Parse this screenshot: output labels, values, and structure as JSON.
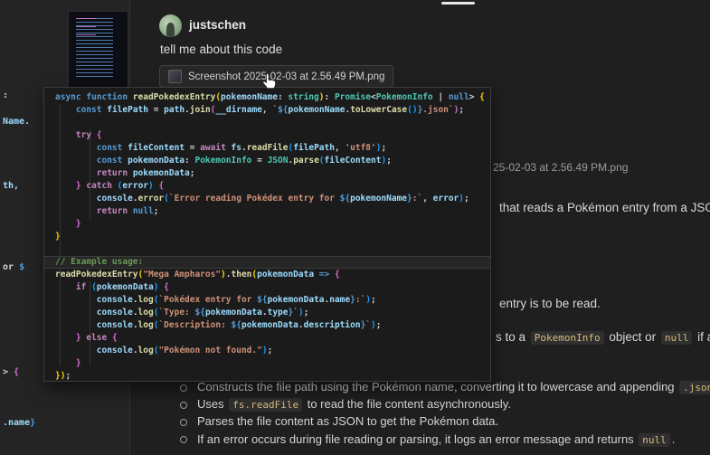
{
  "colors": {
    "editor_bg": "#242424",
    "chat_bg": "#1f1f1f",
    "popup_bg": "#1b1b1b",
    "popup_border": "#3c3c3c",
    "syntax": {
      "keyword": "#569CD6",
      "control": "#C586C0",
      "function": "#DCDCAA",
      "variable": "#9CDCFE",
      "type": "#4EC9B0",
      "string": "#CE9178",
      "comment": "#6A9955",
      "text": "#D4D4D4",
      "bracket1": "#FFD602",
      "bracket2": "#DA70D6",
      "bracket3": "#179FFF"
    },
    "inline_code_fg": "#d7ba7d"
  },
  "chat": {
    "username": "justschen",
    "message": "tell me about this code",
    "attachment": {
      "filename": "Screenshot 2025-02-03 at 2.56.49 PM.png"
    }
  },
  "editor_fragments": [
    [
      [
        "p",
        ":"
      ]
    ],
    [
      [
        "v",
        "Name."
      ]
    ],
    [
      [
        "v",
        "th,"
      ]
    ],
    [
      [
        "p",
        "or "
      ],
      [
        "kw",
        "$"
      ]
    ],
    [
      [
        "p",
        "> "
      ],
      [
        "b2",
        "{"
      ]
    ],
    [
      [
        "v",
        ".name"
      ],
      [
        "kw",
        "}"
      ]
    ]
  ],
  "hover_popup": {
    "highlight_line": 13,
    "code_lines": [
      [
        [
          "kw",
          "async function "
        ],
        [
          "fn",
          "readPokedexEntry"
        ],
        [
          "b1",
          "("
        ],
        [
          "v",
          "pokemonName"
        ],
        [
          "p",
          ": "
        ],
        [
          "ty",
          "string"
        ],
        [
          "b1",
          ")"
        ],
        [
          "p",
          ": "
        ],
        [
          "ty",
          "Promise"
        ],
        [
          "p",
          "<"
        ],
        [
          "ty",
          "PokemonInfo"
        ],
        [
          "p",
          " | "
        ],
        [
          "kw",
          "null"
        ],
        [
          "p",
          "> "
        ],
        [
          "b1",
          "{"
        ]
      ],
      [
        [
          "p",
          "    "
        ],
        [
          "kw",
          "const "
        ],
        [
          "v",
          "filePath"
        ],
        [
          "p",
          " = "
        ],
        [
          "v",
          "path"
        ],
        [
          "p",
          "."
        ],
        [
          "fn",
          "join"
        ],
        [
          "b2",
          "("
        ],
        [
          "v",
          "__dirname"
        ],
        [
          "p",
          ", "
        ],
        [
          "s",
          "`"
        ],
        [
          "kw",
          "${"
        ],
        [
          "v",
          "pokemonName"
        ],
        [
          "p",
          "."
        ],
        [
          "fn",
          "toLowerCase"
        ],
        [
          "b3",
          "()"
        ],
        [
          "kw",
          "}"
        ],
        [
          "s",
          ".json`"
        ],
        [
          "b2",
          ")"
        ],
        [
          "p",
          ";"
        ]
      ],
      [],
      [
        [
          "p",
          "    "
        ],
        [
          "ctl",
          "try "
        ],
        [
          "b2",
          "{"
        ]
      ],
      [
        [
          "p",
          "        "
        ],
        [
          "kw",
          "const "
        ],
        [
          "v",
          "fileContent"
        ],
        [
          "p",
          " = "
        ],
        [
          "ctl",
          "await "
        ],
        [
          "v",
          "fs"
        ],
        [
          "p",
          "."
        ],
        [
          "fn",
          "readFile"
        ],
        [
          "b3",
          "("
        ],
        [
          "v",
          "filePath"
        ],
        [
          "p",
          ", "
        ],
        [
          "s",
          "'utf8'"
        ],
        [
          "b3",
          ")"
        ],
        [
          "p",
          ";"
        ]
      ],
      [
        [
          "p",
          "        "
        ],
        [
          "kw",
          "const "
        ],
        [
          "v",
          "pokemonData"
        ],
        [
          "p",
          ": "
        ],
        [
          "ty",
          "PokemonInfo"
        ],
        [
          "p",
          " = "
        ],
        [
          "ty",
          "JSON"
        ],
        [
          "p",
          "."
        ],
        [
          "fn",
          "parse"
        ],
        [
          "b3",
          "("
        ],
        [
          "v",
          "fileContent"
        ],
        [
          "b3",
          ")"
        ],
        [
          "p",
          ";"
        ]
      ],
      [
        [
          "p",
          "        "
        ],
        [
          "ctl",
          "return "
        ],
        [
          "v",
          "pokemonData"
        ],
        [
          "p",
          ";"
        ]
      ],
      [
        [
          "p",
          "    "
        ],
        [
          "b2",
          "}"
        ],
        [
          "ctl",
          " catch "
        ],
        [
          "b3",
          "("
        ],
        [
          "v",
          "error"
        ],
        [
          "b3",
          ")"
        ],
        [
          "b2",
          " {"
        ]
      ],
      [
        [
          "p",
          "        "
        ],
        [
          "v",
          "console"
        ],
        [
          "p",
          "."
        ],
        [
          "fn",
          "error"
        ],
        [
          "b3",
          "("
        ],
        [
          "s",
          "`Error reading Pokédex entry for "
        ],
        [
          "kw",
          "${"
        ],
        [
          "v",
          "pokemonName"
        ],
        [
          "kw",
          "}"
        ],
        [
          "s",
          ":`"
        ],
        [
          "p",
          ", "
        ],
        [
          "v",
          "error"
        ],
        [
          "b3",
          ")"
        ],
        [
          "p",
          ";"
        ]
      ],
      [
        [
          "p",
          "        "
        ],
        [
          "ctl",
          "return "
        ],
        [
          "kw",
          "null"
        ],
        [
          "p",
          ";"
        ]
      ],
      [
        [
          "p",
          "    "
        ],
        [
          "b2",
          "}"
        ]
      ],
      [
        [
          "b1",
          "}"
        ]
      ],
      [],
      [
        [
          "c",
          "// Example usage:"
        ]
      ],
      [
        [
          "fn",
          "readPokedexEntry"
        ],
        [
          "b1",
          "("
        ],
        [
          "s",
          "\"Mega Ampharos\""
        ],
        [
          "b1",
          ")"
        ],
        [
          "p",
          "."
        ],
        [
          "fn",
          "then"
        ],
        [
          "b1",
          "("
        ],
        [
          "v",
          "pokemonData"
        ],
        [
          "kw",
          " => "
        ],
        [
          "b2",
          "{"
        ]
      ],
      [
        [
          "p",
          "    "
        ],
        [
          "ctl",
          "if "
        ],
        [
          "b3",
          "("
        ],
        [
          "v",
          "pokemonData"
        ],
        [
          "b3",
          ")"
        ],
        [
          "b2",
          " {"
        ]
      ],
      [
        [
          "p",
          "        "
        ],
        [
          "v",
          "console"
        ],
        [
          "p",
          "."
        ],
        [
          "fn",
          "log"
        ],
        [
          "b3",
          "("
        ],
        [
          "s",
          "`Pokédex entry for "
        ],
        [
          "kw",
          "${"
        ],
        [
          "v",
          "pokemonData"
        ],
        [
          "p",
          "."
        ],
        [
          "v",
          "name"
        ],
        [
          "kw",
          "}"
        ],
        [
          "s",
          ":`"
        ],
        [
          "b3",
          ")"
        ],
        [
          "p",
          ";"
        ]
      ],
      [
        [
          "p",
          "        "
        ],
        [
          "v",
          "console"
        ],
        [
          "p",
          "."
        ],
        [
          "fn",
          "log"
        ],
        [
          "b3",
          "("
        ],
        [
          "s",
          "`Type: "
        ],
        [
          "kw",
          "${"
        ],
        [
          "v",
          "pokemonData"
        ],
        [
          "p",
          "."
        ],
        [
          "v",
          "type"
        ],
        [
          "kw",
          "}"
        ],
        [
          "s",
          "`"
        ],
        [
          "b3",
          ")"
        ],
        [
          "p",
          ";"
        ]
      ],
      [
        [
          "p",
          "        "
        ],
        [
          "v",
          "console"
        ],
        [
          "p",
          "."
        ],
        [
          "fn",
          "log"
        ],
        [
          "b3",
          "("
        ],
        [
          "s",
          "`Description: "
        ],
        [
          "kw",
          "${"
        ],
        [
          "v",
          "pokemonData"
        ],
        [
          "p",
          "."
        ],
        [
          "v",
          "description"
        ],
        [
          "kw",
          "}"
        ],
        [
          "s",
          "`"
        ],
        [
          "b3",
          ")"
        ],
        [
          "p",
          ";"
        ]
      ],
      [
        [
          "p",
          "    "
        ],
        [
          "b2",
          "}"
        ],
        [
          "ctl",
          " else "
        ],
        [
          "b2",
          "{"
        ]
      ],
      [
        [
          "p",
          "        "
        ],
        [
          "v",
          "console"
        ],
        [
          "p",
          "."
        ],
        [
          "fn",
          "log"
        ],
        [
          "b3",
          "("
        ],
        [
          "s",
          "\"Pokémon not found.\""
        ],
        [
          "b3",
          ")"
        ],
        [
          "p",
          ";"
        ]
      ],
      [
        [
          "p",
          "    "
        ],
        [
          "b2",
          "}"
        ]
      ],
      [
        [
          "b1",
          "})"
        ],
        [
          "p",
          ";"
        ]
      ]
    ]
  },
  "background_text": {
    "frag_filename": "25-02-03 at 2.56.49 PM.png",
    "frag_line1": "that reads a Pokémon entry from a JSON",
    "frag_line2": "entry is to be read.",
    "frag_line3_segments": [
      {
        "t": "s to a "
      },
      {
        "c": "PokemonInfo"
      },
      {
        "t": " object or "
      },
      {
        "c": "null"
      },
      {
        "t": " if an"
      }
    ],
    "bullets": [
      [
        {
          "t": "Constructs the file path using the Pokémon name, converting it to lowercase and appending "
        },
        {
          "c": ".json"
        }
      ],
      [
        {
          "t": "Uses "
        },
        {
          "c": "fs.readFile"
        },
        {
          "t": " to read the file content asynchronously."
        }
      ],
      [
        {
          "t": "Parses the file content as JSON to get the Pokémon data."
        }
      ],
      [
        {
          "t": "If an error occurs during file reading or parsing, it logs an error message and returns "
        },
        {
          "c": "null"
        },
        {
          "t": "."
        }
      ]
    ]
  }
}
